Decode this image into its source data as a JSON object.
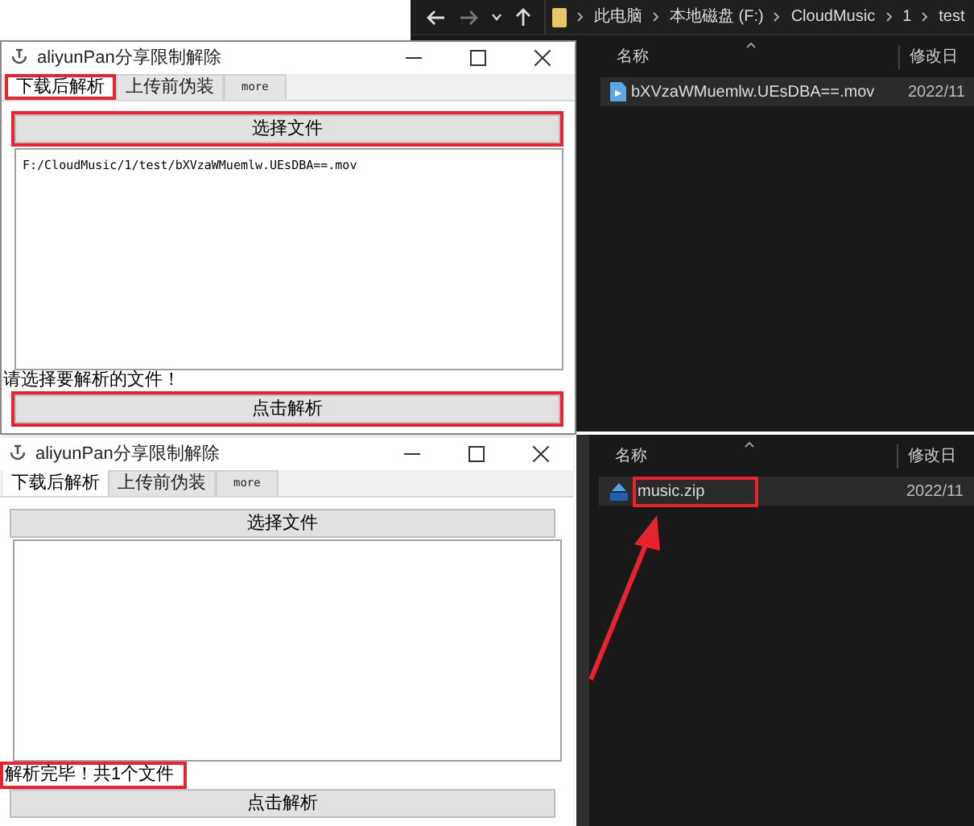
{
  "app_windows": [
    {
      "title": "aliyunPan分享限制解除",
      "tabs": [
        {
          "label": "下载后解析",
          "selected": true,
          "annotated": true
        },
        {
          "label": "上传前伪装",
          "selected": false,
          "annotated": false
        },
        {
          "label": "more",
          "selected": false,
          "annotated": false
        }
      ],
      "select_button": {
        "label": "选择文件",
        "annotated": true
      },
      "output_lines": [
        "F:/CloudMusic/1/test/bXVzaWMuemlw.UEsDBA==.mov"
      ],
      "status": {
        "text": "请选择要解析的文件！",
        "annotated": false
      },
      "parse_button": {
        "label": "点击解析",
        "annotated": true
      }
    },
    {
      "title": "aliyunPan分享限制解除",
      "tabs": [
        {
          "label": "下载后解析",
          "selected": true,
          "annotated": false
        },
        {
          "label": "上传前伪装",
          "selected": false,
          "annotated": false
        },
        {
          "label": "more",
          "selected": false,
          "annotated": false
        }
      ],
      "select_button": {
        "label": "选择文件",
        "annotated": false
      },
      "status": {
        "text": "解析完毕！共1个文件",
        "annotated": true
      },
      "parse_button": {
        "label": "点击解析",
        "annotated": false
      }
    }
  ],
  "explorer_windows": [
    {
      "breadcrumb": [
        "此电脑",
        "本地磁盘 (F:)",
        "CloudMusic",
        "1",
        "test"
      ],
      "columns": [
        "名称",
        "修改日"
      ],
      "files": [
        {
          "name": "bXVzaWMuemlw.UEsDBA==.mov",
          "date": "2022/11",
          "kind": "video",
          "annotated": false
        }
      ]
    },
    {
      "columns": [
        "名称",
        "修改日"
      ],
      "files": [
        {
          "name": "music.zip",
          "date": "2022/11",
          "kind": "zip",
          "annotated": true
        }
      ]
    }
  ],
  "annotations": [
    {
      "kind": "arrow"
    }
  ]
}
